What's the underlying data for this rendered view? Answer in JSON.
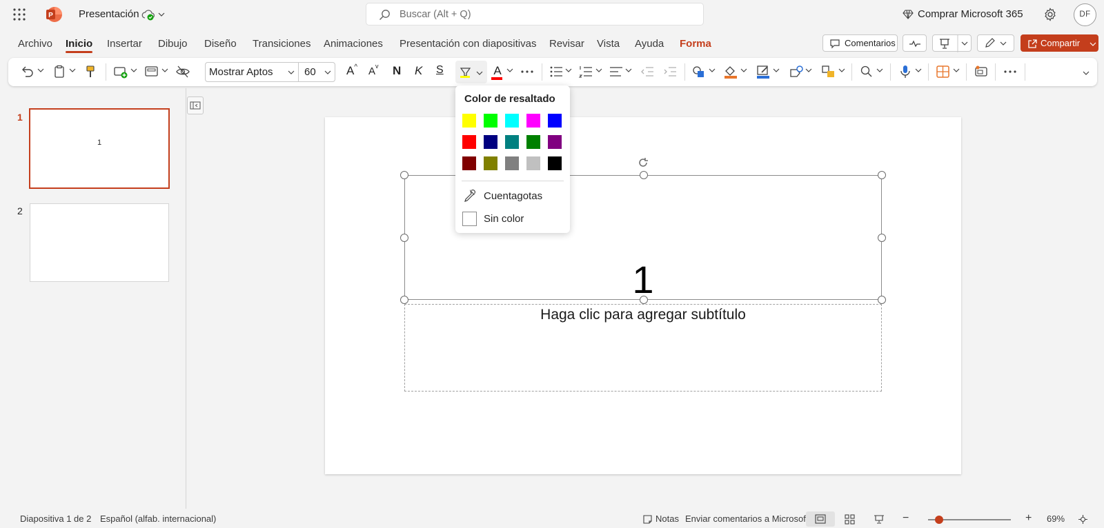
{
  "app": {
    "doc_title": "Presentación",
    "search_placeholder": "Buscar (Alt + Q)",
    "buy_label": "Comprar Microsoft 365",
    "avatar_initials": "DF",
    "accent_color": "#c43e1c"
  },
  "tabs": [
    "Archivo",
    "Inicio",
    "Insertar",
    "Dibujo",
    "Diseño",
    "Transiciones",
    "Animaciones",
    "Presentación con diapositivas",
    "Revisar",
    "Vista",
    "Ayuda",
    "Forma"
  ],
  "active_tab": "Inicio",
  "top_buttons": {
    "comments": "Comentarios",
    "share": "Compartir"
  },
  "ribbon": {
    "font_name": "Mostrar Aptos",
    "font_size": "60",
    "bold_glyph": "N",
    "italic_glyph": "K",
    "underline_glyph": "S",
    "font_color_glyph": "A",
    "grow_glyph": "A",
    "shrink_glyph": "A"
  },
  "thumbnails": {
    "slide1_num": "1",
    "slide1_text": "1",
    "slide2_num": "2"
  },
  "slide": {
    "title": "1",
    "subtitle": "Haga clic para agregar subtítulo"
  },
  "highlight_menu": {
    "title": "Color de resaltado",
    "colors": [
      [
        "#ffff00",
        "#00ff00",
        "#00ffff",
        "#ff00ff",
        "#0000ff"
      ],
      [
        "#ff0000",
        "#000080",
        "#008080",
        "#008000",
        "#800080"
      ],
      [
        "#800000",
        "#808000",
        "#808080",
        "#c0c0c0",
        "#000000"
      ]
    ],
    "eyedropper": "Cuentagotas",
    "no_color": "Sin color"
  },
  "status": {
    "slide_info": "Diapositiva 1 de 2",
    "language": "Español (alfab. internacional)",
    "notes": "Notas",
    "feedback": "Enviar comentarios a Microsoft",
    "zoom_minus": "−",
    "zoom_plus": "+",
    "zoom": "69%"
  }
}
